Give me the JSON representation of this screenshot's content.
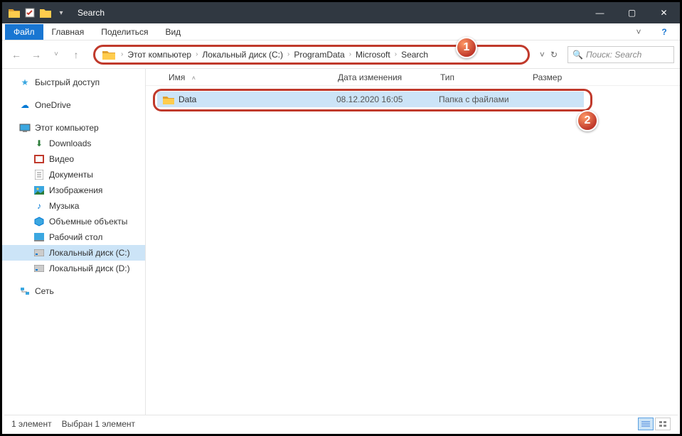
{
  "titlebar": {
    "title": "Search"
  },
  "win_controls": {
    "min": "—",
    "max": "▢",
    "close": "✕"
  },
  "menu": {
    "file": "Файл",
    "home": "Главная",
    "share": "Поделиться",
    "view": "Вид"
  },
  "nav": {
    "back": "←",
    "fwd": "→",
    "dd": "˅",
    "up": "↑"
  },
  "breadcrumb": {
    "items": [
      "Этот компьютер",
      "Локальный диск (C:)",
      "ProgramData",
      "Microsoft",
      "Search"
    ],
    "sep": "›"
  },
  "addr_actions": {
    "dropdown": "˅",
    "refresh": "↻"
  },
  "search": {
    "placeholder": "Поиск: Search",
    "icon": "🔍"
  },
  "columns": {
    "name": "Имя",
    "date": "Дата изменения",
    "type": "Тип",
    "size": "Размер"
  },
  "rows": [
    {
      "name": "Data",
      "date": "08.12.2020 16:05",
      "type": "Папка с файлами"
    }
  ],
  "sidebar": {
    "quick": "Быстрый доступ",
    "onedrive": "OneDrive",
    "pc": "Этот компьютер",
    "downloads": "Downloads",
    "video": "Видео",
    "docs": "Документы",
    "pics": "Изображения",
    "music": "Музыка",
    "obj3d": "Объемные объекты",
    "desktop": "Рабочий стол",
    "drive_c": "Локальный диск (C:)",
    "drive_d": "Локальный диск (D:)",
    "network": "Сеть"
  },
  "status": {
    "count": "1 элемент",
    "selected": "Выбран 1 элемент"
  },
  "badges": {
    "b1": "1",
    "b2": "2"
  }
}
